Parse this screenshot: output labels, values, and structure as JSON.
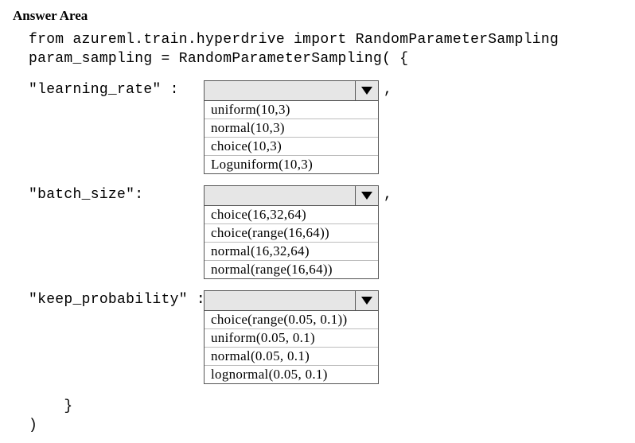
{
  "title": "Answer Area",
  "code": {
    "line1": "from azureml.train.hyperdrive import RandomParameterSampling",
    "line2": "param_sampling = RandomParameterSampling( {"
  },
  "params": [
    {
      "label": "\"learning_rate\" :",
      "trailing_comma": ",",
      "options": [
        "uniform(10,3)",
        "normal(10,3)",
        "choice(10,3)",
        "Loguniform(10,3)"
      ]
    },
    {
      "label": "\"batch_size\":",
      "trailing_comma": ",",
      "options": [
        "choice(16,32,64)",
        "choice(range(16,64))",
        "normal(16,32,64)",
        "normal(range(16,64))"
      ]
    },
    {
      "label": "\"keep_probability\" :",
      "trailing_comma": "",
      "options": [
        "choice(range(0.05, 0.1))",
        "uniform(0.05, 0.1)",
        "normal(0.05, 0.1)",
        "lognormal(0.05, 0.1)"
      ]
    }
  ],
  "closing": {
    "brace": "    }",
    "paren": ")"
  }
}
